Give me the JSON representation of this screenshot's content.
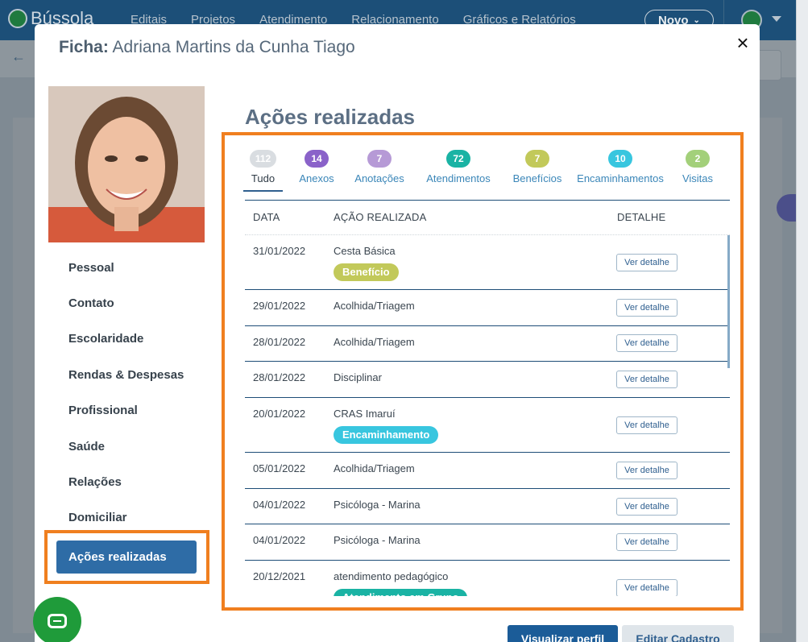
{
  "app": {
    "brand": "Bússola",
    "nav": [
      "Editais",
      "Projetos",
      "Atendimento",
      "Relacionamento",
      "Gráficos e Relatórios"
    ],
    "new_button": "Novo"
  },
  "modal": {
    "title_prefix": "Ficha:",
    "title_name": "Adriana Martins da Cunha Tiago",
    "close_symbol": "×"
  },
  "sidebar": {
    "items": [
      {
        "label": "Pessoal"
      },
      {
        "label": "Contato"
      },
      {
        "label": "Escolaridade"
      },
      {
        "label": "Rendas & Despesas"
      },
      {
        "label": "Profissional"
      },
      {
        "label": "Saúde"
      },
      {
        "label": "Relações"
      },
      {
        "label": "Domiciliar"
      }
    ],
    "active": "Ações realizadas"
  },
  "section_title": "Ações realizadas",
  "tabs": [
    {
      "label": "Tudo",
      "count": "112",
      "color": "#d9dde1"
    },
    {
      "label": "Anexos",
      "count": "14",
      "color": "#8a62c9"
    },
    {
      "label": "Anotações",
      "count": "7",
      "color": "#b69ad6"
    },
    {
      "label": "Atendimentos",
      "count": "72",
      "color": "#1ab3a4"
    },
    {
      "label": "Benefícios",
      "count": "7",
      "color": "#c2c95a"
    },
    {
      "label": "Encaminhamentos",
      "count": "10",
      "color": "#38c6df"
    },
    {
      "label": "Visitas",
      "count": "2",
      "color": "#a3d07a"
    }
  ],
  "table": {
    "headers": [
      "DATA",
      "AÇÃO REALIZADA",
      "DETALHE"
    ],
    "detail_label": "Ver detalhe",
    "rows": [
      {
        "date": "31/01/2022",
        "action": "Cesta Básica",
        "tag": "Benefício",
        "tag_color": "#c2c95a"
      },
      {
        "date": "29/01/2022",
        "action": "Acolhida/Triagem",
        "tag": "",
        "tag_color": ""
      },
      {
        "date": "28/01/2022",
        "action": "Acolhida/Triagem",
        "tag": "",
        "tag_color": ""
      },
      {
        "date": "28/01/2022",
        "action": "Disciplinar",
        "tag": "",
        "tag_color": ""
      },
      {
        "date": "20/01/2022",
        "action": "CRAS Imaruí",
        "tag": "Encaminhamento",
        "tag_color": "#38c6df"
      },
      {
        "date": "05/01/2022",
        "action": "Acolhida/Triagem",
        "tag": "",
        "tag_color": ""
      },
      {
        "date": "04/01/2022",
        "action": "Psicóloga - Marina",
        "tag": "",
        "tag_color": ""
      },
      {
        "date": "04/01/2022",
        "action": "Psicóloga - Marina",
        "tag": "",
        "tag_color": ""
      },
      {
        "date": "20/12/2021",
        "action": "atendimento pedagógico",
        "tag": "Atendimento em Grupo",
        "tag_color": "#1ab3a4"
      }
    ]
  },
  "footer": {
    "view_profile": "Visualizar perfil",
    "edit": "Editar Cadastro"
  },
  "colors": {
    "highlight_frame": "#f07f1f",
    "primary": "#1b5c98"
  }
}
